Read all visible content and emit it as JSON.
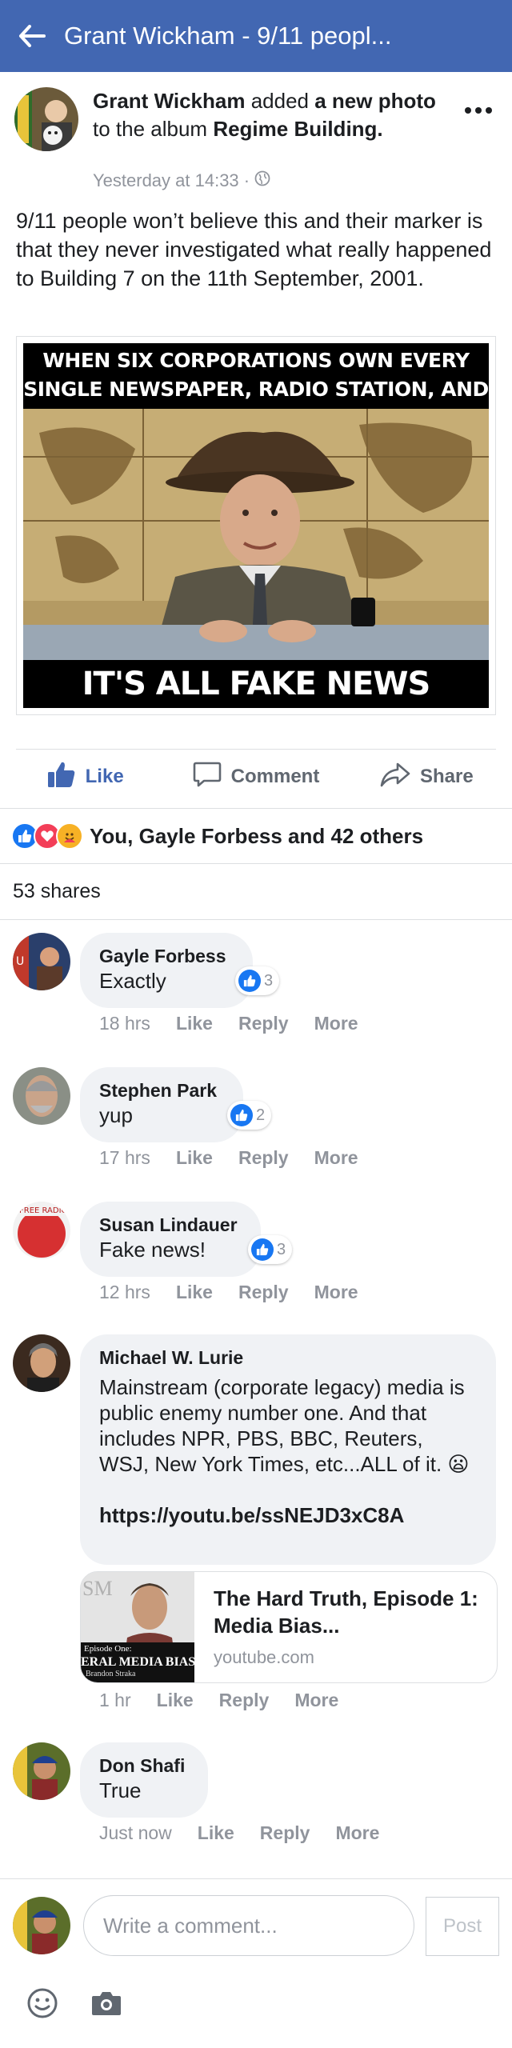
{
  "header": {
    "title": "Grant Wickham - 9/11 peopl..."
  },
  "post": {
    "author": "Grant Wickham",
    "verb_1": " added ",
    "object": "a new photo",
    "verb_2": " to the album ",
    "album": "Regime Building.",
    "timestamp": "Yesterday at 14:33 ·",
    "text": "9/11 people won’t believe this and their marker is that they never investigated what really happened to Building 7 on the 11th September, 2001.",
    "image": {
      "top_text": "WHEN SIX CORPORATIONS OWN EVERY SINGLE NEWSPAPER, RADIO STATION, AND TV CHANNEL",
      "bottom_text": "IT'S ALL FAKE NEWS BUDDY!"
    }
  },
  "actions": {
    "like": "Like",
    "comment": "Comment",
    "share": "Share"
  },
  "reactions": {
    "summary": "You, Gayle Forbess and 42 others",
    "shares": "53 shares"
  },
  "comment_actions": {
    "like": "Like",
    "reply": "Reply",
    "more": "More"
  },
  "comments": [
    {
      "name": "Gayle Forbess",
      "text": "Exactly",
      "likes": "3",
      "time": "18 hrs"
    },
    {
      "name": "Stephen Park",
      "text": "yup",
      "likes": "2",
      "time": "17 hrs"
    },
    {
      "name": "Susan Lindauer",
      "text": "Fake news!",
      "likes": "3",
      "time": "12 hrs"
    },
    {
      "name": "Michael W. Lurie",
      "text": "Mainstream (corporate legacy) media is public enemy number one. And that includes NPR, PBS, BBC, Reuters, WSJ, New York Times, etc...ALL of it. 😦",
      "link": "https://youtu.be/ssNEJD3xC8A",
      "time": "1 hr",
      "card": {
        "title": "The Hard Truth, Episode 1: Media Bias...",
        "domain": "youtube.com",
        "thumb_caption": "Episode One:",
        "thumb_title": "ERAL MEDIA BIAS",
        "thumb_sub": "Brandon Straka",
        "thumb_logo": "SM"
      }
    },
    {
      "name": "Don Shafi",
      "text": "True",
      "time": "Just now"
    }
  ],
  "composer": {
    "placeholder": "Write a comment...",
    "post_label": "Post"
  },
  "colors": {
    "brand_blue": "#4267b2",
    "like_blue": "#1877f2",
    "bubble_gray": "#f0f2f5",
    "meta_gray": "#90949c"
  }
}
